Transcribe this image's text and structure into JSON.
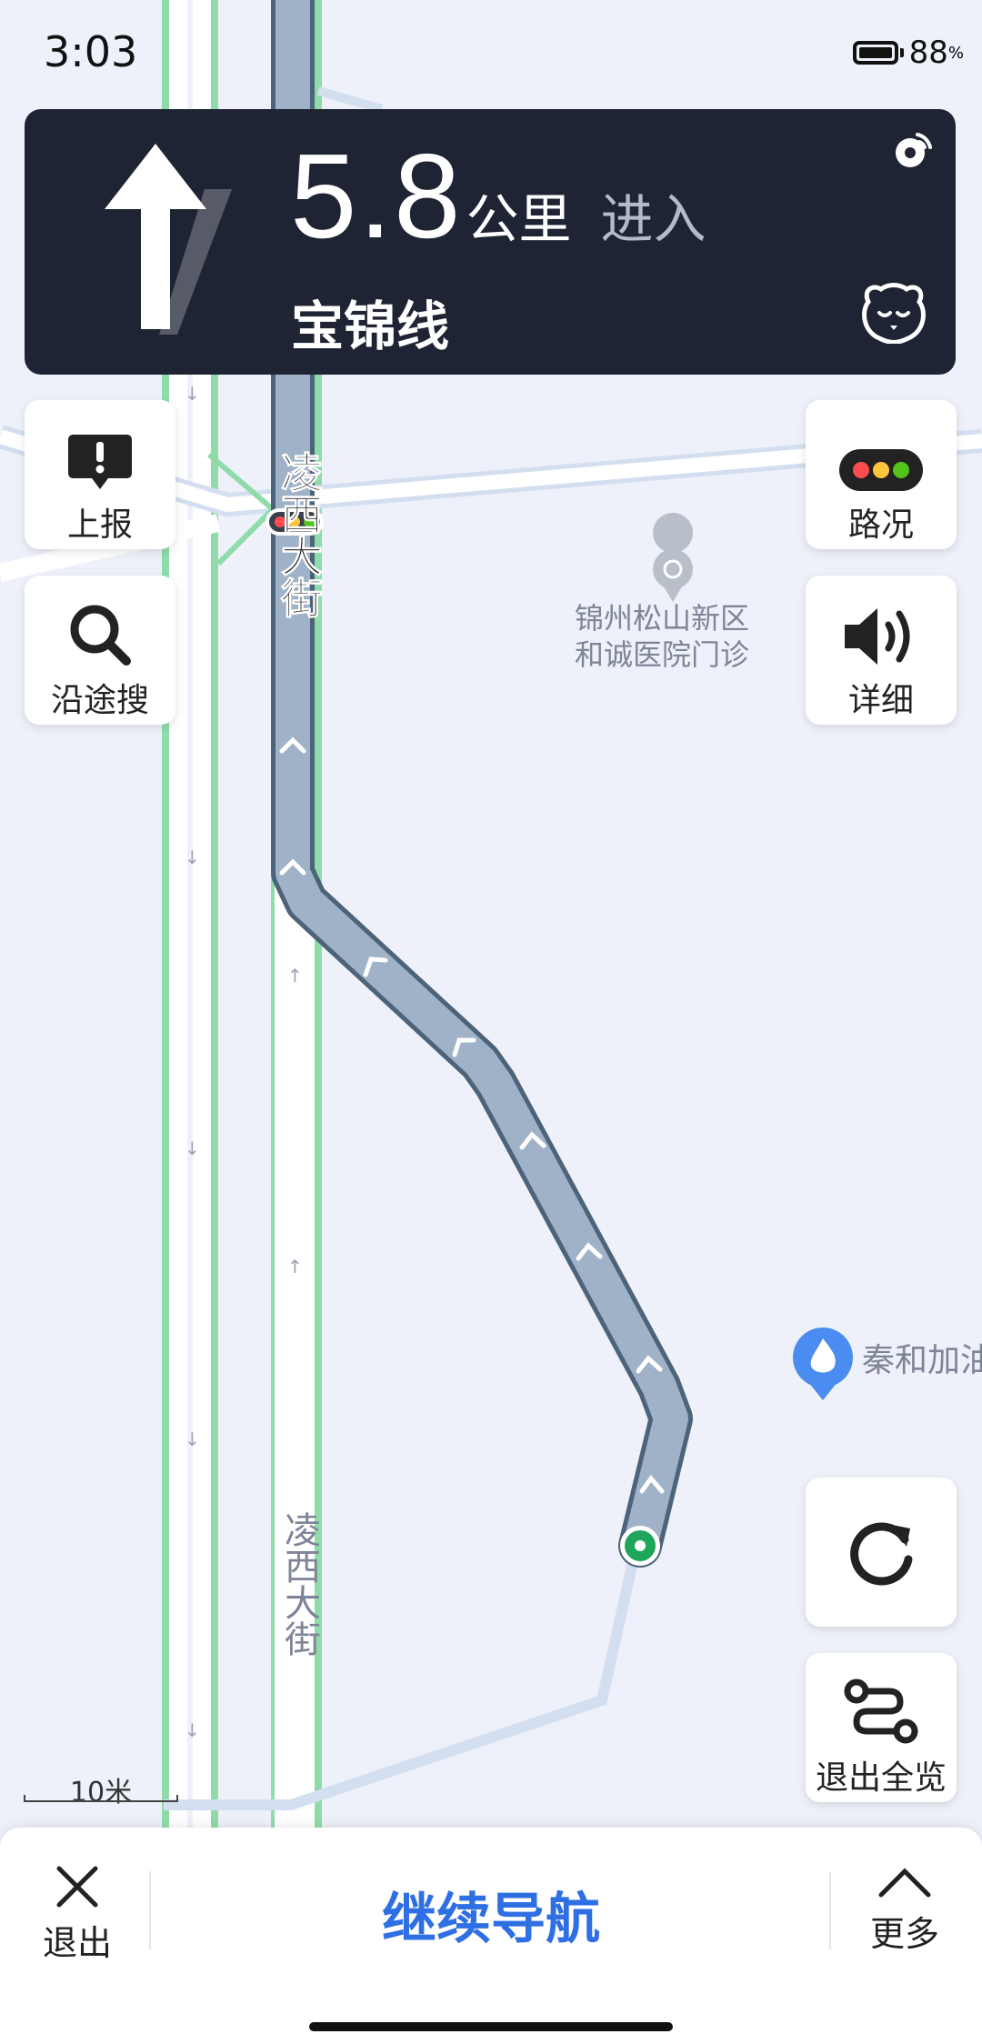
{
  "status_bar": {
    "time": "3:03",
    "battery_level": "88",
    "battery_unit": "%"
  },
  "guidance": {
    "distance_value": "5.8",
    "distance_unit": "公里",
    "action": "进入",
    "road_name": "宝锦线",
    "maneuver_icon": "straight-arrow-icon"
  },
  "map": {
    "top_road_name": "凌西大街",
    "bottom_road_name": "凌西大街",
    "poi_hospital": [
      "锦州松山新区",
      "和诚医院门诊"
    ],
    "poi_gas_station": "秦和加油站",
    "scale_label": "10米"
  },
  "map_buttons": {
    "report": "上报",
    "search_along_route": "沿途搜",
    "traffic": "路况",
    "detail": "详细",
    "exit_overview": "退出全览"
  },
  "bottom_bar": {
    "exit": "退出",
    "continue_navigation": "继续导航",
    "more": "更多"
  },
  "colors": {
    "card_bg": "#1f2434",
    "route": "#9fb2c8",
    "accent": "#2f6fe4",
    "traffic_green": "#8fdcaa"
  }
}
